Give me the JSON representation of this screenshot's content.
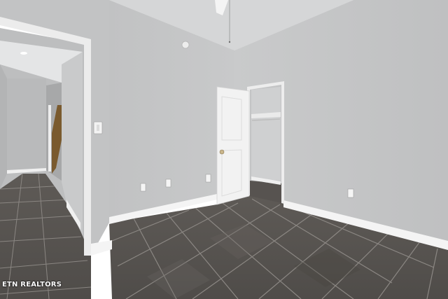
{
  "watermark": {
    "text": "ETN REALTORS"
  },
  "colors": {
    "wall_right": "#c6c7c8",
    "wall_center": "#c4c5c6",
    "ceiling": "#d6d7d8",
    "floor_tile": "#5b5855",
    "grout": "#8a8682",
    "trim": "#f4f4f4",
    "door": "#f2f2f2",
    "hallway_wall": "#b8b9ba"
  },
  "icons": [
    "light-switch-icon",
    "outlet-icon",
    "smoke-detector-icon",
    "ceiling-fan-icon",
    "door-handle-icon"
  ]
}
